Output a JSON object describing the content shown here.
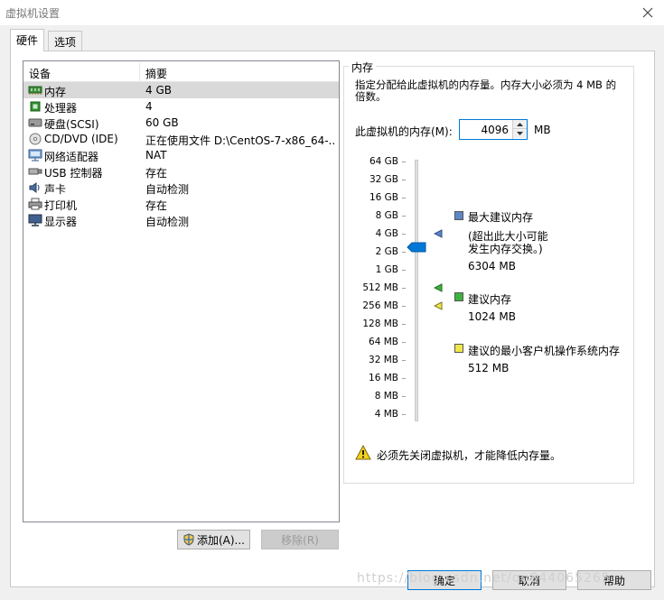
{
  "window": {
    "title": "虚拟机设置"
  },
  "tabs": [
    {
      "label": "硬件",
      "active": true
    },
    {
      "label": "选项",
      "active": false
    }
  ],
  "device_list": {
    "headers": [
      "设备",
      "摘要"
    ],
    "rows": [
      {
        "icon": "memory-icon",
        "name": "内存",
        "summary": "4 GB",
        "selected": true
      },
      {
        "icon": "processor-icon",
        "name": "处理器",
        "summary": "4"
      },
      {
        "icon": "hard-disk-icon",
        "name": "硬盘(SCSI)",
        "summary": "60 GB"
      },
      {
        "icon": "cd-dvd-icon",
        "name": "CD/DVD (IDE)",
        "summary": "正在使用文件 D:\\CentOS-7-x86_64-..."
      },
      {
        "icon": "network-adapter-icon",
        "name": "网络适配器",
        "summary": "NAT"
      },
      {
        "icon": "usb-icon",
        "name": "USB 控制器",
        "summary": "存在"
      },
      {
        "icon": "sound-card-icon",
        "name": "声卡",
        "summary": "自动检测"
      },
      {
        "icon": "printer-icon",
        "name": "打印机",
        "summary": "存在"
      },
      {
        "icon": "display-icon",
        "name": "显示器",
        "summary": "自动检测"
      }
    ]
  },
  "buttons": {
    "add": "添加(A)...",
    "remove": "移除(R)",
    "ok": "确定",
    "cancel": "取消",
    "help": "帮助"
  },
  "memory": {
    "group_title": "内存",
    "description": "指定分配给此虚拟机的内存量。内存大小必须为 4 MB 的倍数。",
    "label": "此虚拟机的内存(M):",
    "value": "4096",
    "unit": "MB",
    "scale_labels": [
      "64 GB",
      "32 GB",
      "16 GB",
      "8 GB",
      "4 GB",
      "2 GB",
      "1 GB",
      "512 MB",
      "256 MB",
      "128 MB",
      "64 MB",
      "32 MB",
      "16 MB",
      "8 MB",
      "4 MB"
    ],
    "legend": {
      "max_title": "最大建议内存",
      "max_note_1": "(超出此大小可能",
      "max_note_2": "发生内存交换。)",
      "max_value": "6304 MB",
      "rec_title": "建议内存",
      "rec_value": "1024 MB",
      "min_title": "建议的最小客户机操作系统内存",
      "min_value": "512 MB"
    },
    "warning": "必须先关闭虚拟机，才能降低内存量。"
  },
  "colors": {
    "max_marker": "#5b86c8",
    "rec_marker": "#3cb33c",
    "min_marker": "#f0e64a",
    "slider_thumb": "#0078d7"
  },
  "watermark": "https://blog.csdn.net/qq844065265"
}
